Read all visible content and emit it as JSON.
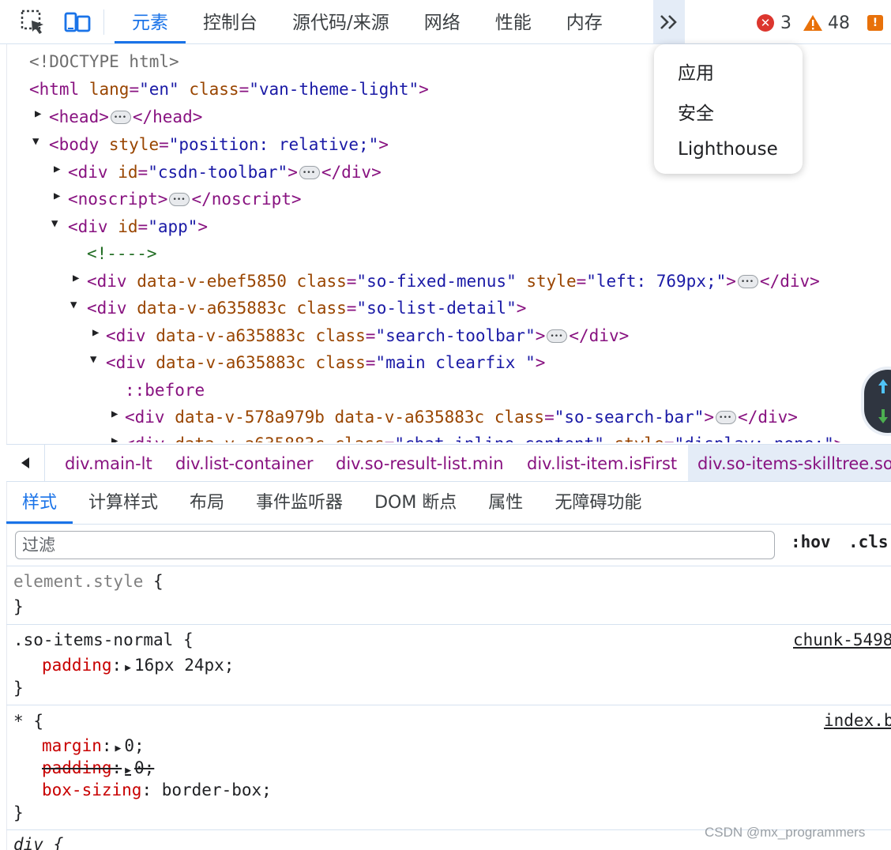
{
  "toolbar": {
    "tabs": [
      "元素",
      "控制台",
      "源代码/来源",
      "网络",
      "性能",
      "内存"
    ],
    "more_label": "»",
    "error_count": "3",
    "warning_count": "48",
    "issue_badge": "!"
  },
  "more_menu": {
    "items": [
      "应用",
      "安全",
      "Lighthouse"
    ]
  },
  "tree": {
    "rows": [
      {
        "t1": "<!DOCTYPE html>"
      },
      {
        "t1": "<html",
        "a1": "lang",
        "v1": "\"en\"",
        "a2": "class",
        "v2": "\"van-theme-light\"",
        "e": ">"
      },
      {
        "t1": "<head>",
        "t2": "</head>"
      },
      {
        "t1": "<body",
        "a1": "style",
        "v1": "\"position: relative;\"",
        "e": ">"
      },
      {
        "t1": "<div",
        "a1": "id",
        "v1": "\"csdn-toolbar\"",
        "e": ">",
        "t2": "</div>"
      },
      {
        "t1": "<noscript>",
        "t2": "</noscript>"
      },
      {
        "t1": "<div",
        "a1": "id",
        "v1": "\"app\"",
        "e": ">"
      },
      {
        "t1": "<!---->"
      },
      {
        "t1": "<div",
        "a0": "data-v-ebef5850",
        "a1": "class",
        "v1": "\"so-fixed-menus\"",
        "a2": "style",
        "v2": "\"left: 769px;\"",
        "e": ">",
        "t2": "</div>"
      },
      {
        "t1": "<div",
        "a0": "data-v-a635883c",
        "a1": "class",
        "v1": "\"so-list-detail\"",
        "e": ">"
      },
      {
        "t1": "<div",
        "a0": "data-v-a635883c",
        "a1": "class",
        "v1": "\"search-toolbar\"",
        "e": ">",
        "t2": "</div>"
      },
      {
        "t1": "<div",
        "a0": "data-v-a635883c",
        "a1": "class",
        "v1": "\"main clearfix \"",
        "e": ">"
      },
      {
        "t1": "::before"
      },
      {
        "t1": "<div",
        "a0": "data-v-578a979b",
        "a0b": "data-v-a635883c",
        "a1": "class",
        "v1": "\"so-search-bar\"",
        "e": ">",
        "t2": "</div>"
      },
      {
        "t1": "<div",
        "a0": "data-v-a635883c",
        "a1": "class",
        "v1": "\"chat-inline-content\"",
        "a2": "style",
        "v2": "\"display: none;\"",
        "e": ">"
      }
    ]
  },
  "breadcrumbs": [
    "div.main-lt",
    "div.list-container",
    "div.so-result-list.min",
    "div.list-item.isFirst",
    "div.so-items-skilltree.so"
  ],
  "style_tabs": [
    "样式",
    "计算样式",
    "布局",
    "事件监听器",
    "DOM 断点",
    "属性",
    "无障碍功能"
  ],
  "filter": {
    "placeholder": "过滤",
    "hov": ":hov",
    "cls": ".cls"
  },
  "rules": {
    "r1": {
      "selector": "element.style",
      "open": "{",
      "close": "}"
    },
    "r2": {
      "selector": ".so-items-normal",
      "open": "{",
      "source": "chunk-5498",
      "p1": "padding",
      "v1": "16px 24px;",
      "close": "}"
    },
    "r3": {
      "selector": "*",
      "open": "{",
      "source": "index.b",
      "p1": "margin",
      "v1": "0;",
      "p2": "padding",
      "v2": "0;",
      "p3": "box-sizing",
      "v3": "border-box;",
      "close": "}"
    },
    "r4": {
      "selector": "div",
      "open": "{"
    }
  },
  "watermark": "CSDN @mx_programmers",
  "colors": {
    "accent": "#1a73e8",
    "tag": "#881280",
    "attr_name": "#994500",
    "attr_value": "#1a1aa6",
    "error": "#dc362e",
    "warning": "#e8710a"
  }
}
